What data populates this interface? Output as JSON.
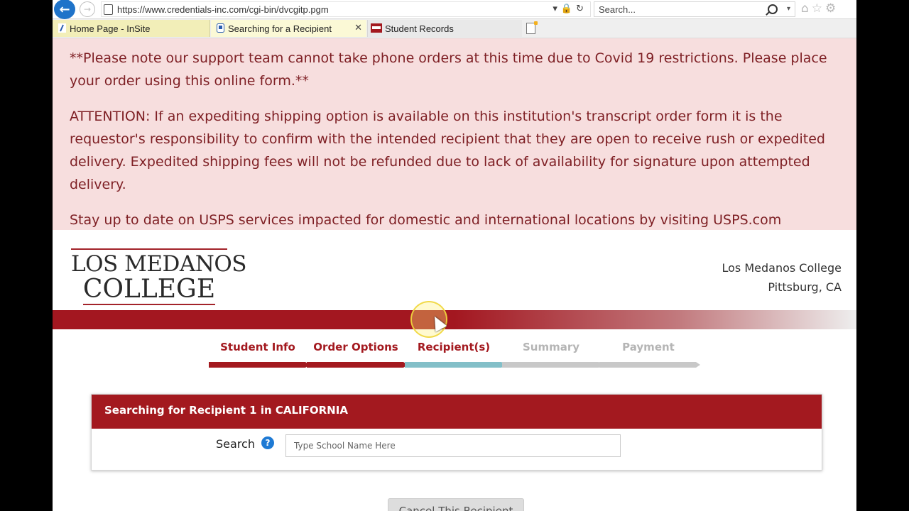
{
  "browser": {
    "url": "https://www.credentials-inc.com/cgi-bin/dvcgitp.pgm",
    "search_placeholder": "Search...",
    "tabs": [
      {
        "label": "Home Page - InSite"
      },
      {
        "label": "Searching for a Recipient",
        "active": true
      },
      {
        "label": "Student Records"
      }
    ],
    "icons": [
      "back-arrow-icon",
      "forward-arrow-icon",
      "lock-icon",
      "refresh-icon",
      "search-icon",
      "home-icon",
      "star-icon",
      "gear-icon"
    ]
  },
  "notice": {
    "line1": "**Please note our support team cannot take phone orders at this time due to Covid 19 restrictions. Please place your order using this online form.**",
    "line2": "ATTENTION: If an expediting shipping option is available on this institution's transcript order form it is the requestor's responsibility to confirm with the intended recipient that they are open to receive rush or expedited delivery. Expedited shipping fees will not be refunded due to lack of availability for signature upon attempted delivery.",
    "line3": "Stay up to date on USPS services impacted for domestic and international locations by visiting USPS.com"
  },
  "header": {
    "logo_line1": "LOS MEDANOS",
    "logo_line2": "COLLEGE",
    "institution_name": "Los Medanos College",
    "institution_location": "Pittsburg, CA"
  },
  "steps": [
    {
      "label": "Student Info",
      "state": "done"
    },
    {
      "label": "Order Options",
      "state": "done"
    },
    {
      "label": "Recipient(s)",
      "state": "active"
    },
    {
      "label": "Summary",
      "state": "todo"
    },
    {
      "label": "Payment",
      "state": "todo"
    }
  ],
  "recipient_panel": {
    "title": "Searching for Recipient 1 in CALIFORNIA",
    "search_label": "Search",
    "search_placeholder": "Type School Name Here"
  },
  "cancel_button_label": "Cancel This Recipient",
  "colors": {
    "brand_red": "#a3191f",
    "notice_bg": "#f7dede",
    "active_step": "#83bfc8",
    "todo_step": "#c8c8c8",
    "help_blue": "#1e7ad4"
  }
}
